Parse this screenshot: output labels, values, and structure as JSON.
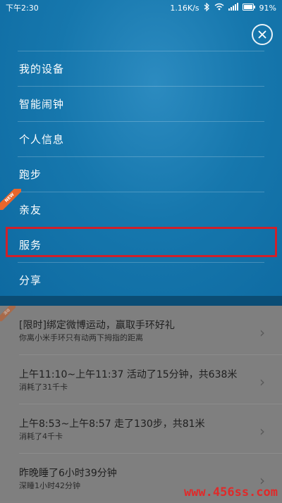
{
  "status_bar": {
    "time": "下午2:30",
    "network_speed": "1.16K/s",
    "battery": "91%",
    "icons": [
      "bluetooth-icon",
      "wifi-icon",
      "signal-icon",
      "battery-icon"
    ]
  },
  "menu": {
    "items": [
      {
        "label": "我的设备"
      },
      {
        "label": "智能闹钟"
      },
      {
        "label": "个人信息"
      },
      {
        "label": "跑步"
      },
      {
        "label": "亲友",
        "badge": "NEW"
      },
      {
        "label": "服务",
        "highlighted": true
      },
      {
        "label": "分享"
      }
    ],
    "close_icon": "close-icon"
  },
  "feed": {
    "ribbon": "活动",
    "items": [
      {
        "title": "[限时]绑定微博运动，赢取手环好礼",
        "subtitle": "你离小米手环只有动两下拇指的距离"
      },
      {
        "title": "上午11:10~上午11:37 活动了15分钟，共638米",
        "subtitle": "消耗了31千卡"
      },
      {
        "title": "上午8:53~上午8:57 走了130步，共81米",
        "subtitle": "消耗了4千卡"
      },
      {
        "title": "昨晚睡了6小时39分钟",
        "subtitle": "深睡1小时42分钟"
      }
    ]
  },
  "watermark": "www.456ss.com",
  "colors": {
    "panel": "#1677ad",
    "highlight": "#d0202a",
    "new_badge": "#e9662c"
  }
}
